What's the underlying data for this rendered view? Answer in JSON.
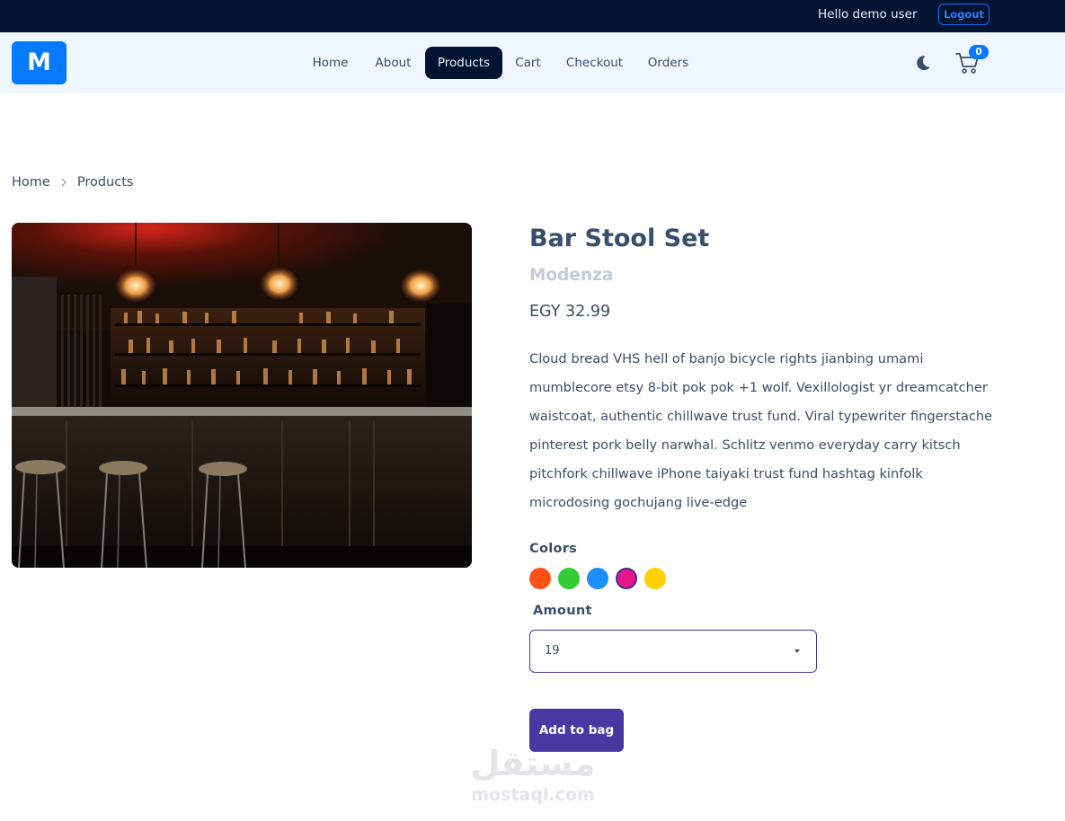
{
  "topbar": {
    "greeting": "Hello demo user",
    "logout_label": "Logout"
  },
  "navbar": {
    "logo_text": "M",
    "links": [
      {
        "label": "Home"
      },
      {
        "label": "About"
      },
      {
        "label": "Products",
        "active": true
      },
      {
        "label": "Cart"
      },
      {
        "label": "Checkout"
      },
      {
        "label": "Orders"
      }
    ],
    "theme_icon": "moon-icon",
    "cart_icon": "cart-icon",
    "cart_count": "0"
  },
  "breadcrumb": [
    "Home",
    "Products"
  ],
  "product": {
    "image_icon": "bar-interior-photo",
    "title": "Bar Stool Set",
    "company": "Modenza",
    "price": "EGY 32.99",
    "description": "Cloud bread VHS hell of banjo bicycle rights jianbing umami mumblecore etsy 8-bit pok pok +1 wolf. Vexillologist yr dreamcatcher waistcoat, authentic chillwave trust fund. Viral typewriter fingerstache pinterest pork belly narwhal. Schlitz venmo everyday carry kitsch pitchfork chillwave iPhone taiyaki trust fund hashtag kinfolk microdosing gochujang live-edge",
    "colors_label": "Colors",
    "colors": [
      "#FF5117",
      "#33CC33",
      "#1F8FFF",
      "#E8168A",
      "#FFD000"
    ],
    "selected_color": "#E8168A",
    "amount_label": "Amount",
    "amount_value": "19",
    "add_button_label": "Add to bag"
  },
  "watermark": {
    "arabic": "مستقل",
    "latin": "mostaql.com"
  },
  "theme": {
    "topbar_bg": "#021431",
    "navbar_bg": "#F0F6FF",
    "primary": "#057AFF",
    "secondary": "#463AA2",
    "text": "#394E6A"
  }
}
